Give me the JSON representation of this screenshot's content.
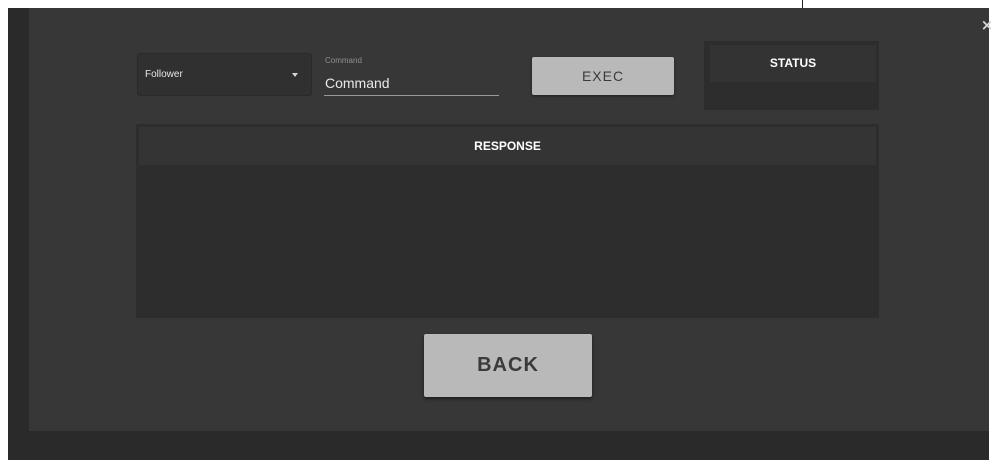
{
  "follower_select": {
    "selected": "Follower",
    "icon": "chevron-down-icon"
  },
  "command_field": {
    "floating_label": "Command",
    "placeholder": "Command",
    "value": ""
  },
  "exec_button": {
    "label": "EXEC"
  },
  "status_panel": {
    "title": "STATUS",
    "value": ""
  },
  "response_panel": {
    "title": "RESPONSE",
    "content": ""
  },
  "back_button": {
    "label": "BACK"
  },
  "close_button": {
    "glyph": "×",
    "icon": "close-icon"
  },
  "colors": {
    "backdrop": "#2a2a2a",
    "dialog": "#373737",
    "panel": "#2d2d2d",
    "panel_header": "#343434",
    "button": "#b9b9b9"
  }
}
